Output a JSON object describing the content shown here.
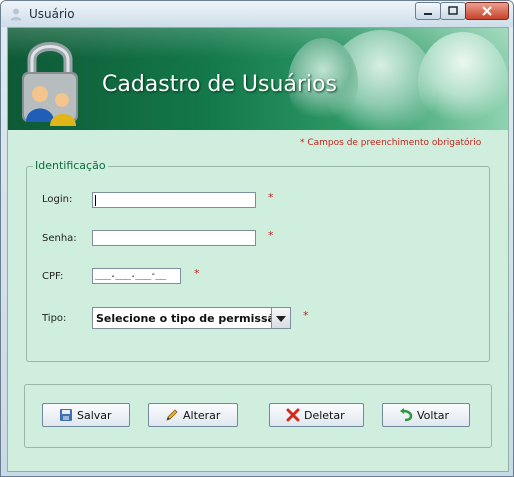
{
  "window": {
    "title": "Usuário"
  },
  "banner": {
    "title": "Cadastro de Usuários"
  },
  "required_note": "* Campos de preenchimento obrigatório",
  "identification": {
    "group_title": "Identificação",
    "login": {
      "label": "Login:",
      "value": "",
      "required": "*"
    },
    "password": {
      "label": "Senha:",
      "value": "",
      "required": "*"
    },
    "cpf": {
      "label": "CPF:",
      "mask": "___.___.___-__",
      "required": "*"
    },
    "type": {
      "label": "Tipo:",
      "selected": "Selecione o tipo de permissão",
      "required": "*"
    }
  },
  "buttons": {
    "save": "Salvar",
    "edit": "Alterar",
    "delete": "Deletar",
    "back": "Voltar"
  },
  "colors": {
    "banner_green": "#13784a",
    "panel_bg": "#cfeedd",
    "required_red": "#c0271f"
  },
  "icons": [
    "user-icon",
    "lock-users-icon",
    "save-icon",
    "pencil-icon",
    "x-icon",
    "back-arrow-icon"
  ]
}
